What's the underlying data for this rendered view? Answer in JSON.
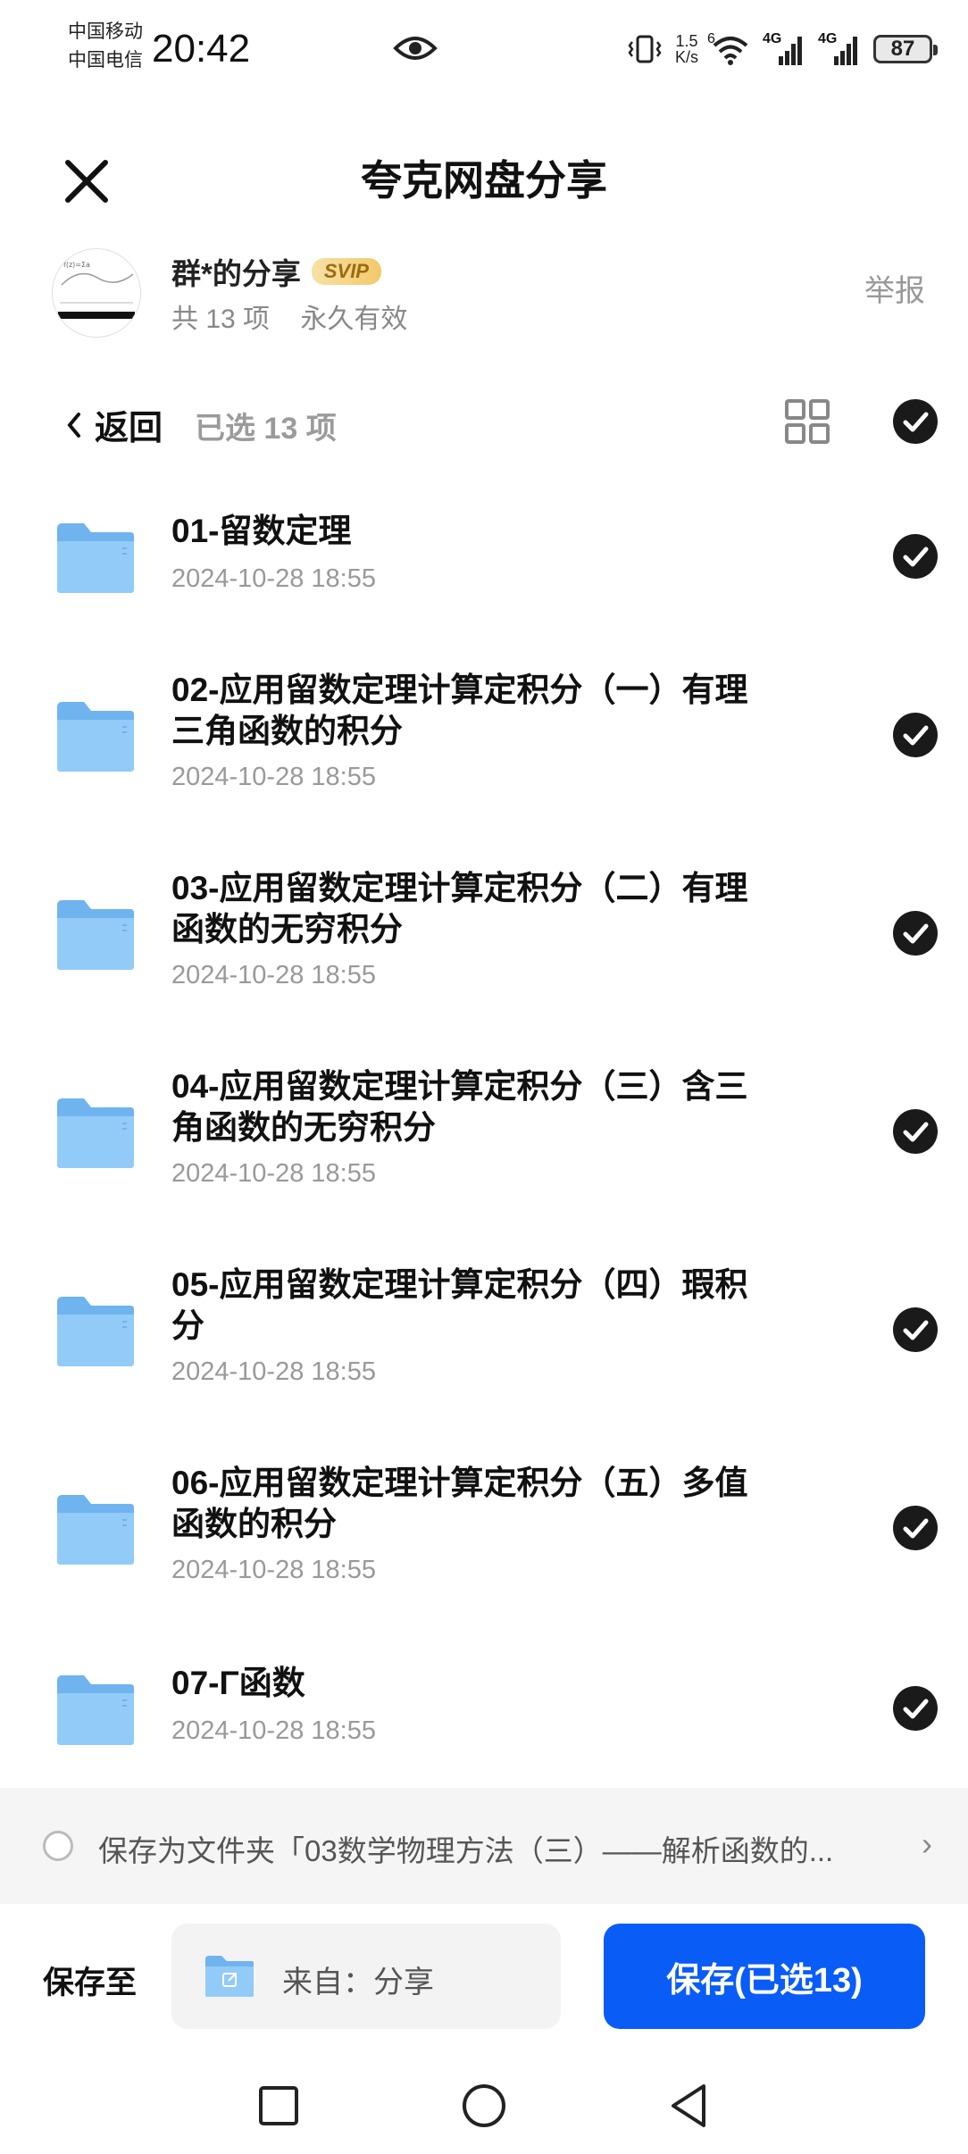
{
  "status_bar": {
    "carrier_1": "中国移动",
    "carrier_2": "中国电信",
    "time": "20:42",
    "net_speed_value": "1.5",
    "net_speed_unit": "K/s",
    "wifi_badge": "6",
    "signal_1": "4G",
    "signal_2": "4G",
    "battery": "87"
  },
  "header": {
    "title": "夸克网盘分享",
    "close_icon": "close-icon"
  },
  "share": {
    "name": "群*的分享",
    "badge": "SVIP",
    "item_count": "共 13 项",
    "validity": "永久有效",
    "report": "举报"
  },
  "toolbar": {
    "back": "返回",
    "selected": "已选 13 项"
  },
  "files": [
    {
      "name": "01-留数定理",
      "date": "2024-10-28 18:55"
    },
    {
      "name": "02-应用留数定理计算定积分（一）有理三角函数的积分",
      "date": "2024-10-28 18:55"
    },
    {
      "name": "03-应用留数定理计算定积分（二）有理函数的无穷积分",
      "date": "2024-10-28 18:55"
    },
    {
      "name": "04-应用留数定理计算定积分（三）含三角函数的无穷积分",
      "date": "2024-10-28 18:55"
    },
    {
      "name": "05-应用留数定理计算定积分（四）瑕积分",
      "date": "2024-10-28 18:55"
    },
    {
      "name": "06-应用留数定理计算定积分（五）多值函数的积分",
      "date": "2024-10-28 18:55"
    },
    {
      "name": "07-Γ函数",
      "date": "2024-10-28 18:55"
    }
  ],
  "save_folder": {
    "text": "保存为文件夹「03数学物理方法（三）——解析函数的..."
  },
  "bottom": {
    "save_to_label": "保存至",
    "source": "来自：分享",
    "save_button": "保存(已选13)"
  },
  "colors": {
    "accent": "#0a5cf7",
    "folder": "#8cc6f5",
    "check": "#1a1a1a"
  }
}
